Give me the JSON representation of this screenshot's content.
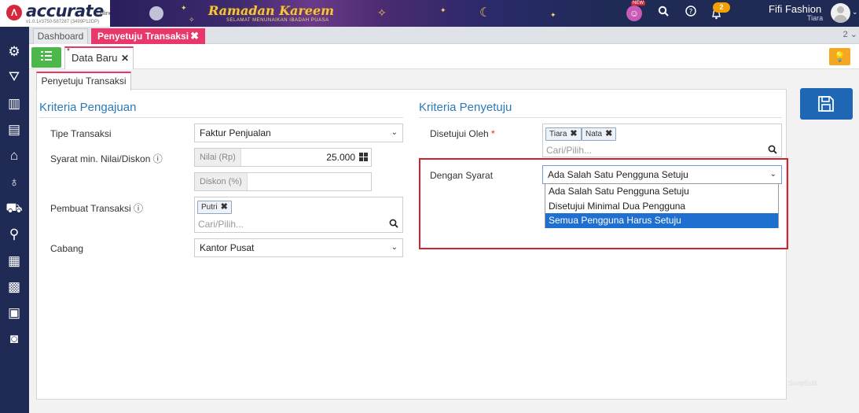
{
  "header": {
    "brand": "accurate",
    "brand_suffix": "online",
    "version": "v1.0.1#3750-587287 (3499P12DP)",
    "banner_title": "Ramadan Kareem",
    "banner_subtitle": "SELAMAT MENUNAIKAN IBADAH PUASA",
    "new_badge": "NEW",
    "notification_count": "2",
    "company": "Fifi Fashion",
    "user": "Tiara"
  },
  "tabs": {
    "dashboard": "Dashboard",
    "active": "Penyetuju Transaksi",
    "count": "2"
  },
  "doc_tab": {
    "modified_mark": "*",
    "label": "Data Baru"
  },
  "section_tab": "Penyetuju Transaksi",
  "left_section": {
    "title": "Kriteria Pengajuan",
    "tipe_label": "Tipe Transaksi",
    "tipe_value": "Faktur Penjualan",
    "syarat_label": "Syarat min. Nilai/Diskon ⓘ",
    "nilai_addon": "Nilai (Rp)",
    "nilai_value": "25.000",
    "diskon_addon": "Diskon (%)",
    "diskon_value": "",
    "pembuat_label": "Pembuat Transaksi ⓘ",
    "pembuat_chips": [
      "Putri"
    ],
    "pembuat_placeholder": "Cari/Pilih...",
    "cabang_label": "Cabang",
    "cabang_value": "Kantor Pusat"
  },
  "right_section": {
    "title": "Kriteria Penyetuju",
    "disetujui_label": "Disetujui Oleh",
    "required_mark": "*",
    "disetujui_chips": [
      "Tiara",
      "Nata"
    ],
    "disetujui_placeholder": "Cari/Pilih...",
    "syarat_label": "Dengan Syarat",
    "syarat_value": "Ada Salah Satu Pengguna Setuju",
    "syarat_options": [
      "Ada Salah Satu Pengguna Setuju",
      "Disetujui Minimal Dua Pengguna",
      "Semua Pengguna Harus Setuju"
    ],
    "highlighted_option": 2
  },
  "watermark": "SnapEdit",
  "colors": {
    "nav": "#1f2a55",
    "accent_pink": "#e8386b",
    "section_blue": "#2a7ab8",
    "save_blue": "#1f67b5",
    "highlight_red": "#d42230",
    "option_selected": "#1e6fd0",
    "green_button": "#4cb84c",
    "bulb_orange": "#f5a623"
  },
  "sidebar_icons": [
    "gear-icon",
    "triangle-people-icon",
    "building-icon",
    "pos-terminal-icon",
    "bank-icon",
    "money-bag-icon",
    "cart-icon",
    "bag-cart-icon",
    "factory-icon",
    "warehouse-icon",
    "report-icon",
    "chart-report-icon"
  ]
}
